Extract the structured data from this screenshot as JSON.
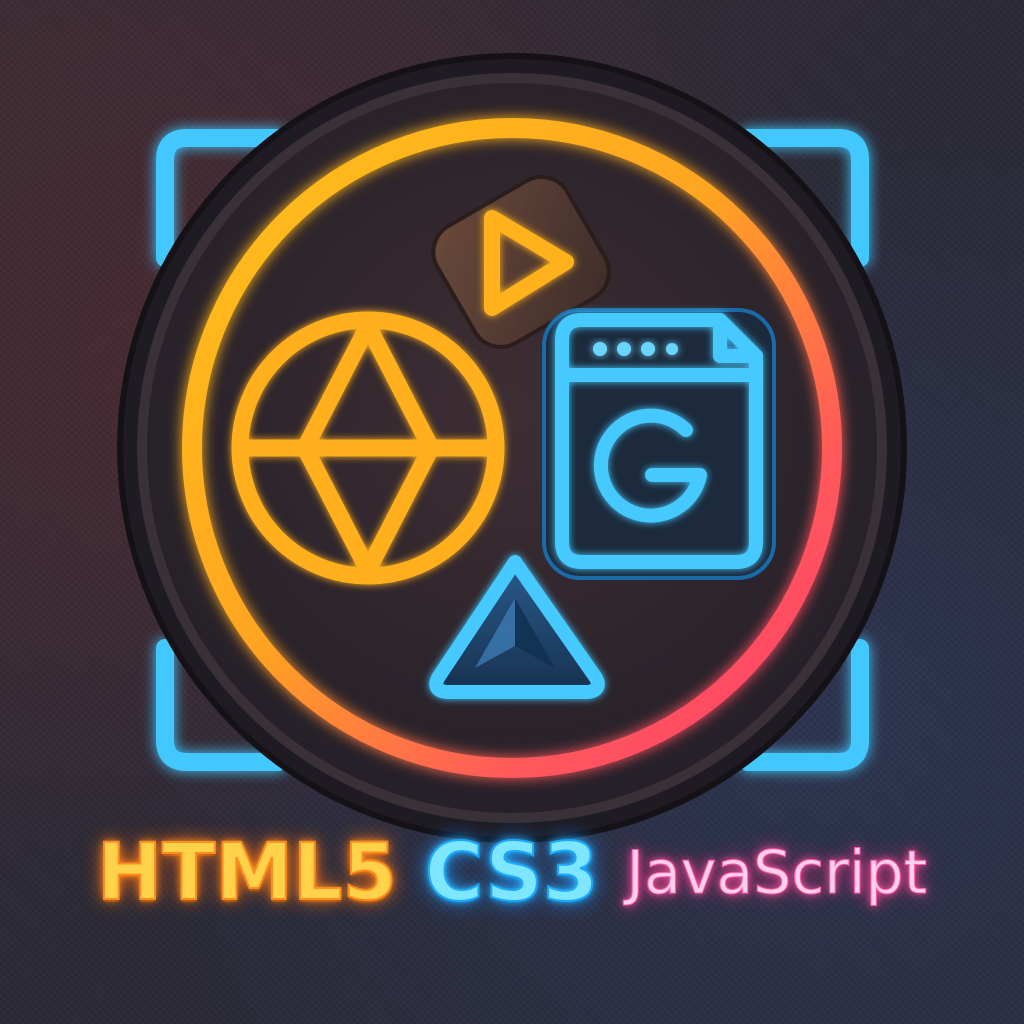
{
  "logo": {
    "labels": {
      "html": "HTML5",
      "css": "CS3",
      "js": "JavaScript"
    },
    "icons": [
      "play-icon",
      "globe-icon",
      "browser-window-icon",
      "triangle-icon",
      "corner-bracket-icon"
    ]
  },
  "colors": {
    "background": "#2b2a36",
    "orange_glow": "#ffb020",
    "pink_glow": "#ff3a6a",
    "blue_glow": "#38c6ff",
    "magenta_text": "#ff5aa8"
  }
}
